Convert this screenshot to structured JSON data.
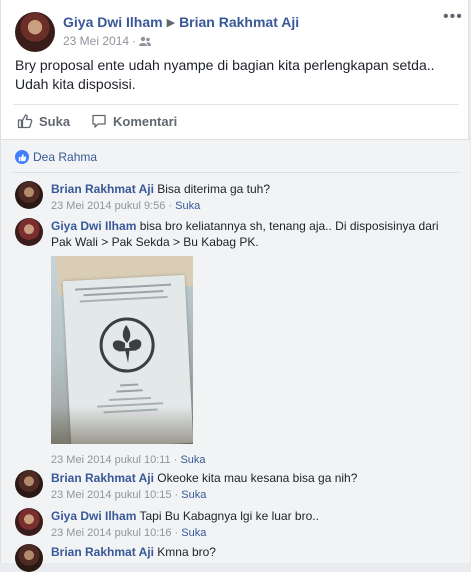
{
  "post": {
    "author": "Giya Dwi Ilham",
    "recipient": "Brian Rakhmat Aji",
    "date": "23 Mei 2014",
    "text": "Bry proposal ente udah nyampe di bagian kita perlengkapan setda.. Udah kita disposisi.",
    "more_label": "•••",
    "like_label": "Suka",
    "comment_label": "Komentari"
  },
  "likes": {
    "names": "Dea Rahma"
  },
  "comments": [
    {
      "author": "Brian Rakhmat Aji",
      "text": "Bisa diterima ga tuh?",
      "time": "23 Mei 2014 pukul 9:56",
      "like": "Suka"
    },
    {
      "author": "Giya Dwi Ilham",
      "text": "bisa bro keliatannya sh, tenang aja.. Di disposisinya dari Pak Wali > Pak Sekda > Bu Kabag PK.",
      "time": "23 Mei 2014 pukul 10:11",
      "like": "Suka"
    },
    {
      "author": "Brian Rakhmat Aji",
      "text": "Okeoke kita mau kesana bisa ga nih?",
      "time": "23 Mei 2014 pukul 10:15",
      "like": "Suka"
    },
    {
      "author": "Giya Dwi Ilham",
      "text": "Tapi Bu Kabagnya lgi ke luar bro..",
      "time": "23 Mei 2014 pukul 10:16",
      "like": "Suka"
    },
    {
      "author": "Brian Rakhmat Aji",
      "text": "Kmna bro?"
    }
  ],
  "colors": {
    "link": "#385898",
    "secondary": "#90949c",
    "background": "#f2f3f5"
  },
  "icons": [
    "people-audience-icon",
    "thumbs-up-icon",
    "comment-icon",
    "like-badge-icon",
    "fleur-de-lis-emblem"
  ]
}
